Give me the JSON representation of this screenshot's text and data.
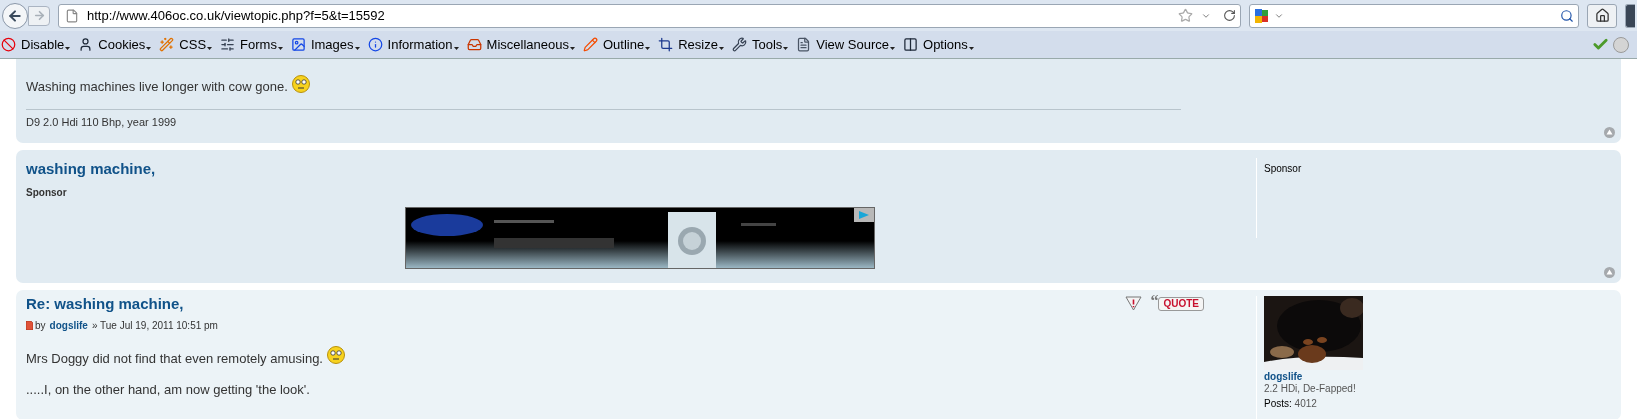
{
  "browser": {
    "url": "http://www.406oc.co.uk/viewtopic.php?f=5&t=15592"
  },
  "toolbar": {
    "items": [
      {
        "label": "Disable"
      },
      {
        "label": "Cookies"
      },
      {
        "label": "CSS"
      },
      {
        "label": "Forms"
      },
      {
        "label": "Images"
      },
      {
        "label": "Information"
      },
      {
        "label": "Miscellaneous"
      },
      {
        "label": "Outline"
      },
      {
        "label": "Resize"
      },
      {
        "label": "Tools"
      },
      {
        "label": "View Source"
      },
      {
        "label": "Options"
      }
    ]
  },
  "posts": [
    {
      "kind": "tail",
      "paragraphs": [
        {
          "text": "Washing machines live longer with cow gone.",
          "smiley": true
        }
      ],
      "signature": "D9 2.0 Hdi 110 Bhp, year 1999"
    },
    {
      "kind": "sponsor",
      "title": "washing machine,",
      "subtitle": "Sponsor",
      "profile": {
        "rank": "Sponsor"
      }
    },
    {
      "kind": "post",
      "title": "Re: washing machine,",
      "by": "by",
      "author": "dogslife",
      "date": "» Tue Jul 19, 2011 10:51 pm",
      "paragraphs": [
        {
          "text": "Mrs Doggy did not find that even remotely amusing.",
          "smiley": true
        },
        {
          "text": ".....I, on the other hand, am now getting 'the look'.",
          "smiley": false
        }
      ],
      "quote_mark": "“",
      "quote_label": "QUOTE",
      "profile": {
        "username": "dogslife",
        "rank": "2.2 HDi, De-Fapped!",
        "posts_label": "Posts:",
        "posts": "4012"
      }
    }
  ]
}
